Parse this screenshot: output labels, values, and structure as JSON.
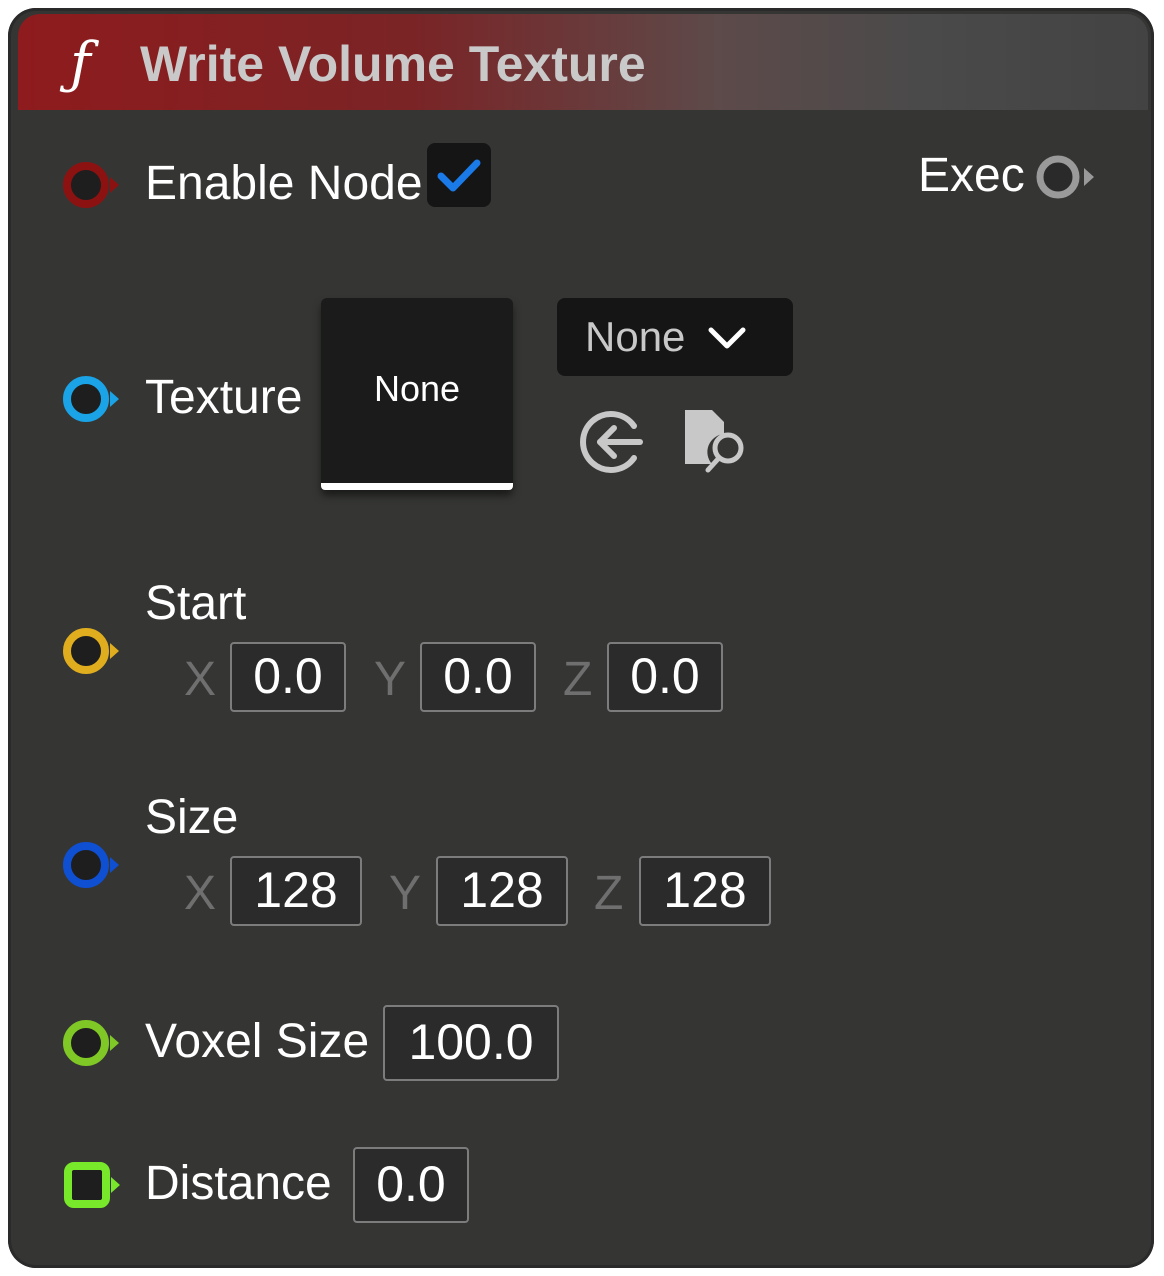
{
  "node": {
    "title": "Write Volume Texture",
    "function_icon": "ƒ",
    "header_color": "#8e1b1d"
  },
  "pins": {
    "enable_node": {
      "label": "Enable Node",
      "checked": true,
      "pin_color": "#a31414"
    },
    "exec": {
      "label": "Exec",
      "pin_color": "#ffffff"
    },
    "texture": {
      "label": "Texture",
      "thumbnail_text": "None",
      "combo_value": "None",
      "pin_color": "#1aa3e6",
      "icons": [
        "use-selected-asset-icon",
        "browse-asset-icon"
      ]
    },
    "start": {
      "label": "Start",
      "pin_color": "#e8b923",
      "x_label": "X",
      "x": "0.0",
      "y_label": "Y",
      "y": "0.0",
      "z_label": "Z",
      "z": "0.0"
    },
    "size": {
      "label": "Size",
      "pin_color": "#0f4fd1",
      "x_label": "X",
      "x": "128",
      "y_label": "Y",
      "y": "128",
      "z_label": "Z",
      "z": "128"
    },
    "voxel_size": {
      "label": "Voxel Size",
      "value": "100.0",
      "pin_color": "#8bd12a"
    },
    "distance": {
      "label": "Distance",
      "value": "0.0",
      "pin_color": "#7ef02a"
    }
  }
}
